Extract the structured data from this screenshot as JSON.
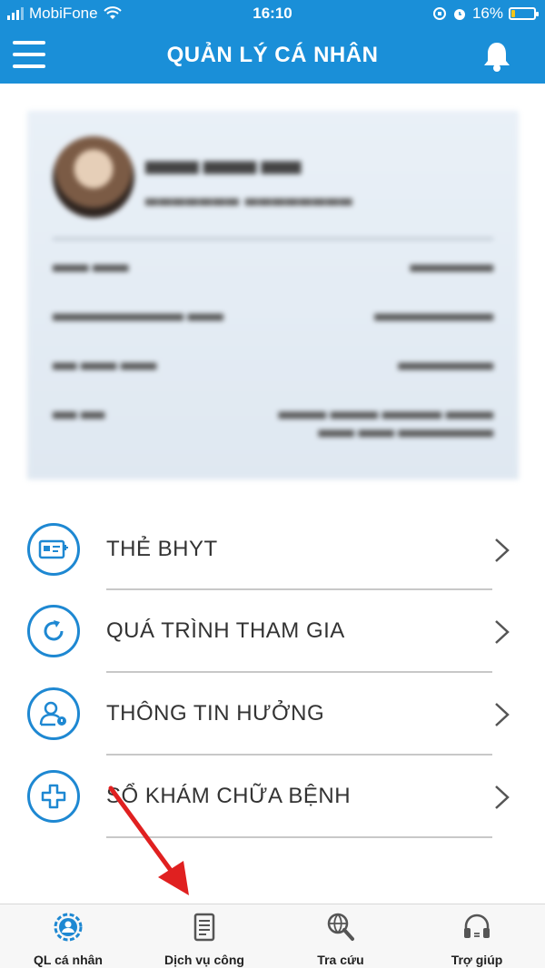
{
  "status_bar": {
    "carrier": "MobiFone",
    "time": "16:10",
    "battery": "16%",
    "battery_level": 0.16
  },
  "header": {
    "title": "QUẢN LÝ CÁ NHÂN"
  },
  "menu": {
    "items": [
      {
        "label": "THẺ BHYT",
        "icon": "health-card-icon"
      },
      {
        "label": "QUÁ TRÌNH THAM GIA",
        "icon": "refresh-arrow-icon"
      },
      {
        "label": "THÔNG TIN HƯỞNG",
        "icon": "user-info-icon"
      },
      {
        "label": "SỔ KHÁM CHỮA BỆNH",
        "icon": "medical-cross-icon"
      }
    ]
  },
  "bottom_nav": {
    "tabs": [
      {
        "label": "QL cá nhân",
        "icon": "personal-gear-icon"
      },
      {
        "label": "Dịch vụ công",
        "icon": "document-icon"
      },
      {
        "label": "Tra cứu",
        "icon": "search-globe-icon"
      },
      {
        "label": "Trợ giúp",
        "icon": "headset-icon"
      }
    ]
  },
  "colors": {
    "primary": "#1a8fd8",
    "icon_blue": "#1e88d2",
    "arrow_red": "#e02020"
  }
}
